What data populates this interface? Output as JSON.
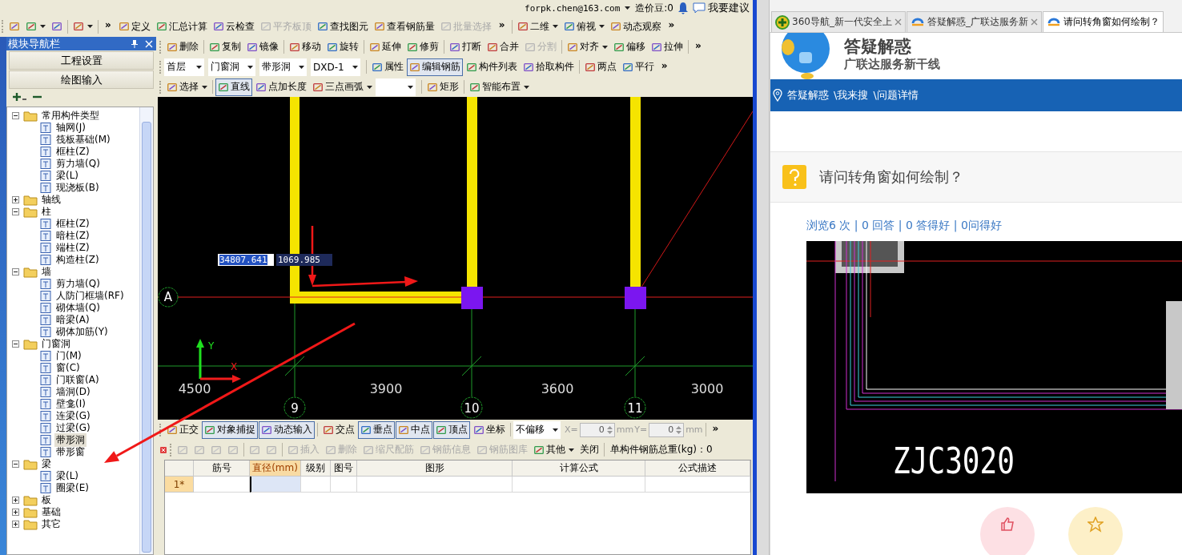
{
  "account": {
    "user": "forpk.chen@163.com",
    "credits": "造价豆:0",
    "feedback": "我要建议"
  },
  "main_toolbar": [
    [
      {
        "kind": "icon"
      },
      {
        "kind": "icon",
        "dropdown": true
      },
      {
        "kind": "icon"
      }
    ],
    [
      {
        "kind": "icon",
        "dropdown": true
      }
    ],
    [
      {
        "kind": "more",
        "label": "»",
        "disabled": false
      },
      {
        "kind": "tool",
        "label": "定义",
        "disabled": false
      },
      {
        "kind": "tool",
        "label": "汇总计算",
        "disabled": false
      },
      {
        "kind": "tool",
        "label": "云检查",
        "disabled": false
      },
      {
        "kind": "tool",
        "label": "平齐板顶",
        "disabled": true
      },
      {
        "kind": "tool",
        "label": "查找图元",
        "disabled": false
      },
      {
        "kind": "tool",
        "label": "查看钢筋量",
        "disabled": false
      },
      {
        "kind": "tool",
        "label": "批量选择",
        "disabled": true
      },
      {
        "kind": "more",
        "label": "»",
        "disabled": false
      }
    ],
    [
      {
        "kind": "tool",
        "label": "二维",
        "dropdown": true
      },
      {
        "kind": "tool",
        "label": "俯视",
        "dropdown": true
      },
      {
        "kind": "tool",
        "label": "动态观察"
      },
      {
        "kind": "more",
        "label": "»"
      }
    ]
  ],
  "nav_panel": {
    "title": "模块导航栏",
    "buttons": [
      "工程设置",
      "绘图输入"
    ],
    "tree": [
      {
        "label": "常用构件类型",
        "expanded": true,
        "selected": false,
        "children": [
          {
            "label": "轴网(J)",
            "selected": false
          },
          {
            "label": "筏板基础(M)",
            "selected": false
          },
          {
            "label": "框柱(Z)",
            "selected": false
          },
          {
            "label": "剪力墙(Q)",
            "selected": false
          },
          {
            "label": "梁(L)",
            "selected": false
          },
          {
            "label": "现浇板(B)",
            "selected": false
          }
        ]
      },
      {
        "label": "轴线",
        "expanded": false,
        "selected": false
      },
      {
        "label": "柱",
        "expanded": true,
        "selected": false,
        "children": [
          {
            "label": "框柱(Z)",
            "selected": false
          },
          {
            "label": "暗柱(Z)",
            "selected": false
          },
          {
            "label": "端柱(Z)",
            "selected": false
          },
          {
            "label": "构造柱(Z)",
            "selected": false
          }
        ]
      },
      {
        "label": "墙",
        "expanded": true,
        "selected": false,
        "children": [
          {
            "label": "剪力墙(Q)",
            "selected": false
          },
          {
            "label": "人防门框墙(RF)",
            "selected": false
          },
          {
            "label": "砌体墙(Q)",
            "selected": false
          },
          {
            "label": "暗梁(A)",
            "selected": false
          },
          {
            "label": "砌体加筋(Y)",
            "selected": false
          }
        ]
      },
      {
        "label": "门窗洞",
        "expanded": true,
        "selected": false,
        "children": [
          {
            "label": "门(M)",
            "selected": false
          },
          {
            "label": "窗(C)",
            "selected": false
          },
          {
            "label": "门联窗(A)",
            "selected": false
          },
          {
            "label": "墙洞(D)",
            "selected": false
          },
          {
            "label": "壁龛(I)",
            "selected": false
          },
          {
            "label": "连梁(G)",
            "selected": false
          },
          {
            "label": "过梁(G)",
            "selected": false
          },
          {
            "label": "带形洞",
            "selected": true
          },
          {
            "label": "带形窗",
            "selected": false
          }
        ]
      },
      {
        "label": "梁",
        "expanded": true,
        "selected": false,
        "children": [
          {
            "label": "梁(L)",
            "selected": false
          },
          {
            "label": "圈梁(E)",
            "selected": false
          }
        ]
      },
      {
        "label": "板",
        "expanded": false,
        "selected": false
      },
      {
        "label": "基础",
        "expanded": false,
        "selected": false
      },
      {
        "label": "其它",
        "expanded": false,
        "selected": false
      }
    ]
  },
  "edit_toolbar": [
    [
      {
        "kind": "tool",
        "label": "删除",
        "disabled": false
      }
    ],
    [
      {
        "kind": "tool",
        "label": "复制",
        "disabled": false
      },
      {
        "kind": "tool",
        "label": "镜像",
        "disabled": false
      }
    ],
    [
      {
        "kind": "tool",
        "label": "移动",
        "disabled": false
      },
      {
        "kind": "tool",
        "label": "旋转",
        "disabled": false
      }
    ],
    [
      {
        "kind": "tool",
        "label": "延伸",
        "disabled": false
      },
      {
        "kind": "tool",
        "label": "修剪",
        "disabled": false
      }
    ],
    [
      {
        "kind": "tool",
        "label": "打断",
        "disabled": false
      },
      {
        "kind": "tool",
        "label": "合并",
        "disabled": false
      },
      {
        "kind": "tool",
        "label": "分割",
        "disabled": true
      }
    ],
    [
      {
        "kind": "tool",
        "label": "对齐",
        "dropdown": true,
        "disabled": false
      },
      {
        "kind": "tool",
        "label": "偏移",
        "disabled": false
      },
      {
        "kind": "tool",
        "label": "拉伸",
        "disabled": false
      }
    ],
    [
      {
        "kind": "more",
        "label": "»",
        "disabled": false
      }
    ]
  ],
  "component_toolbar": [
    [
      {
        "kind": "select",
        "label": "首层"
      },
      {
        "kind": "select",
        "label": "门窗洞"
      },
      {
        "kind": "select",
        "label": "带形洞"
      },
      {
        "kind": "select",
        "label": "DXD-1"
      }
    ],
    [
      {
        "kind": "tool",
        "label": "属性",
        "pressed": false
      },
      {
        "kind": "tool",
        "label": "编辑钢筋",
        "pressed": true
      },
      {
        "kind": "tool",
        "label": "构件列表",
        "pressed": false
      },
      {
        "kind": "tool",
        "label": "拾取构件",
        "pressed": false
      }
    ],
    [
      {
        "kind": "tool",
        "label": "两点"
      },
      {
        "kind": "tool",
        "label": "平行"
      },
      {
        "kind": "more",
        "label": "»"
      }
    ]
  ],
  "draw_toolbar": [
    [
      {
        "kind": "tool",
        "label": "选择",
        "dropdown": true,
        "pressed": false
      }
    ],
    [
      {
        "kind": "tool",
        "label": "直线",
        "pressed": true
      },
      {
        "kind": "tool",
        "label": "点加长度",
        "pressed": false
      },
      {
        "kind": "tool",
        "label": "三点画弧",
        "dropdown": true,
        "pressed": false
      },
      {
        "kind": "select",
        "pressed": false
      }
    ],
    [
      {
        "kind": "tool",
        "label": "矩形"
      }
    ],
    [
      {
        "kind": "tool",
        "label": "智能布置",
        "dropdown": true
      }
    ]
  ],
  "canvas": {
    "coord_inputs": [
      {
        "value": "34807.641",
        "selected": true
      },
      {
        "value": "1069.985",
        "selected": false
      }
    ],
    "row_axes": [
      "A"
    ],
    "column_axes": [
      "9",
      "10",
      "11"
    ],
    "spans": [
      "4500",
      "3900",
      "3600",
      "3000"
    ],
    "ucs": {
      "y_label": "Y",
      "x_label": "X"
    }
  },
  "snap_toolbar": [
    [
      {
        "kind": "tool",
        "label": "正交",
        "pressed": false
      },
      {
        "kind": "tool",
        "label": "对象捕捉",
        "pressed": true
      },
      {
        "kind": "tool",
        "label": "动态输入",
        "pressed": true
      }
    ],
    [
      {
        "kind": "tool",
        "label": "交点",
        "pressed": false
      },
      {
        "kind": "tool",
        "label": "垂点",
        "pressed": true
      },
      {
        "kind": "tool",
        "label": "中点",
        "pressed": true
      },
      {
        "kind": "tool",
        "label": "顶点",
        "pressed": true
      },
      {
        "kind": "tool",
        "label": "坐标",
        "pressed": false
      }
    ],
    [
      {
        "kind": "select",
        "label": "不偏移",
        "disabled": false
      },
      {
        "kind": "spin",
        "label": "X=",
        "value": "0",
        "unit": "mm",
        "disabled": true
      },
      {
        "kind": "spin",
        "label": "Y=",
        "value": "0",
        "unit": "mm",
        "disabled": true
      }
    ],
    [
      {
        "kind": "more",
        "label": "»"
      }
    ]
  ],
  "rebar_toolbar": [
    [
      {
        "kind": "icon",
        "disabled": true
      },
      {
        "kind": "icon",
        "disabled": true
      },
      {
        "kind": "icon",
        "disabled": true
      },
      {
        "kind": "icon",
        "disabled": true
      }
    ],
    [
      {
        "kind": "icon",
        "disabled": true
      },
      {
        "kind": "icon",
        "disabled": true
      }
    ],
    [
      {
        "kind": "tool",
        "label": "插入",
        "disabled": true
      },
      {
        "kind": "tool",
        "label": "删除",
        "disabled": true
      },
      {
        "kind": "tool",
        "label": "缩尺配筋",
        "disabled": true
      },
      {
        "kind": "tool",
        "label": "钢筋信息",
        "disabled": true
      },
      {
        "kind": "tool",
        "label": "钢筋图库",
        "disabled": true
      },
      {
        "kind": "tool",
        "label": "其他",
        "dropdown": true,
        "disabled": false
      },
      {
        "kind": "button",
        "label": "关闭",
        "disabled": false
      }
    ],
    [
      {
        "kind": "text",
        "label": "单构件钢筋总重(kg)：0"
      }
    ]
  ],
  "rebar_table": {
    "columns": [
      {
        "label": "筋号",
        "selected": false
      },
      {
        "label": "直径(mm)",
        "selected": true
      },
      {
        "label": "级别",
        "selected": false
      },
      {
        "label": "图号",
        "selected": false
      },
      {
        "label": "图形",
        "selected": false
      },
      {
        "label": "计算公式",
        "selected": false
      },
      {
        "label": "公式描述",
        "selected": false
      }
    ],
    "rows": [
      {
        "header": "1*",
        "selected": true
      }
    ]
  },
  "browser": {
    "tabs": [
      {
        "title": "360导航_新一代安全上",
        "selected": false,
        "closable": true
      },
      {
        "title": "答疑解惑_广联达服务新",
        "selected": false,
        "closable": true
      },
      {
        "title": "请问转角窗如何绘制？",
        "selected": true,
        "closable": false
      }
    ],
    "header": {
      "title": "答疑解惑",
      "tagline": "广联达服务新干线"
    },
    "breadcrumb": [
      "答疑解惑",
      "\\我来搜",
      "\\问题详情"
    ],
    "question": {
      "title": "请问转角窗如何绘制？",
      "stats": "浏览6 次 | 0 回答 | 0 答得好 | 0问得好",
      "image_label": "ZJC3020"
    }
  }
}
